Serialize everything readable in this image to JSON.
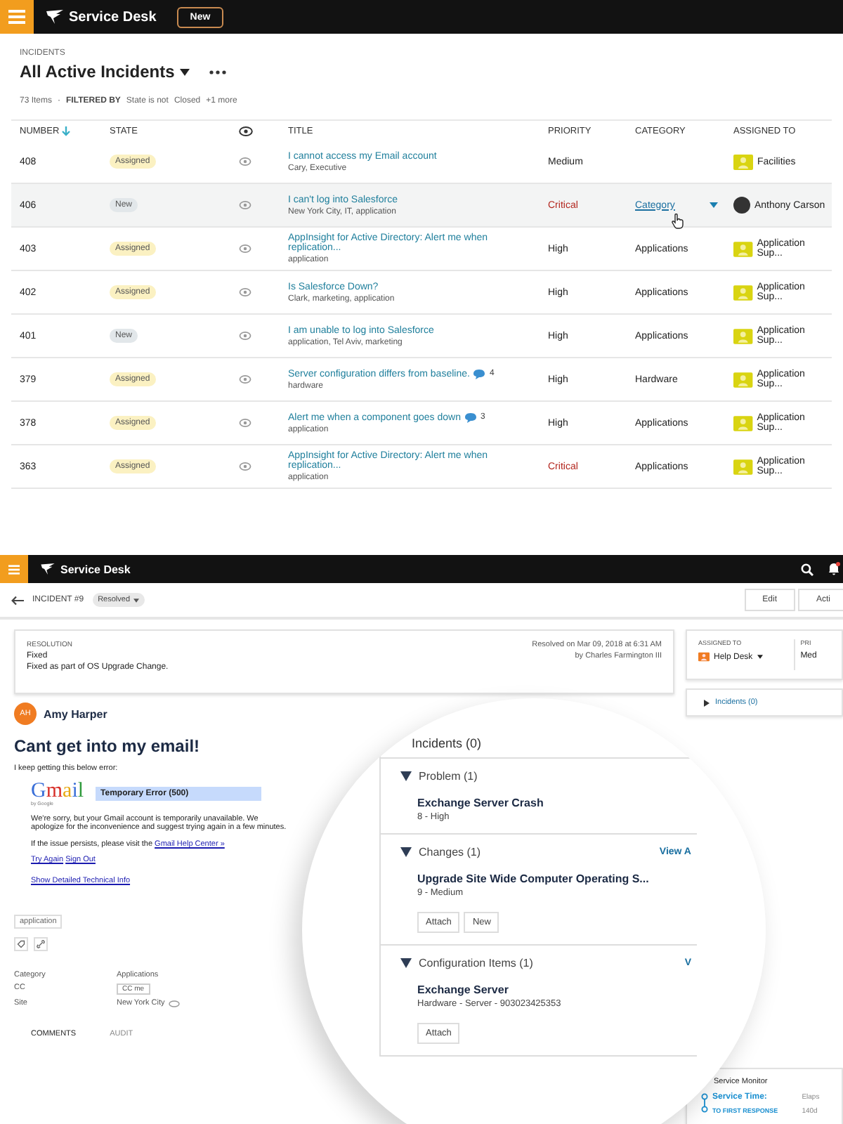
{
  "list_screen": {
    "app_title": "Service Desk",
    "new_button": "New",
    "breadcrumb": "INCIDENTS",
    "view_title": "All Active Incidents",
    "item_count": "73 Items",
    "separator": "·",
    "filter_label": "FILTERED BY",
    "filters": [
      "State is not",
      "Closed",
      "+1 more"
    ],
    "columns": [
      {
        "label": "NUMBER",
        "kind": "sorted"
      },
      {
        "label": "STATE",
        "kind": "text"
      },
      {
        "kind": "eye"
      },
      {
        "label": "TITLE",
        "kind": "text"
      },
      {
        "label": "PRIORITY",
        "kind": "text"
      },
      {
        "label": "CATEGORY",
        "kind": "text"
      },
      {
        "label": "ASSIGNED TO",
        "kind": "text"
      }
    ],
    "rows": [
      {
        "number": "408",
        "badge": {
          "label": "Assigned",
          "kind": "assigned"
        },
        "title": "I cannot access my Email account",
        "tags": "Cary, Executive",
        "priority": "Medium",
        "critical": false,
        "category_link": false,
        "assignee": {
          "name": "Facilities",
          "kind": "group"
        },
        "selected": false
      },
      {
        "number": "406",
        "badge": {
          "label": "New",
          "kind": "new"
        },
        "title": "I can't log into Salesforce",
        "tags": "New York City, IT, application",
        "priority": "Critical",
        "critical": true,
        "category": "Category",
        "category_link": true,
        "assignee": {
          "name": "Anthony Carson",
          "kind": "person"
        },
        "selected": true
      },
      {
        "number": "403",
        "badge": {
          "label": "Assigned",
          "kind": "assigned"
        },
        "title": "AppInsight for Active Directory: Alert me when replication...",
        "tags": "application",
        "priority": "High",
        "critical": false,
        "category": "Applications",
        "category_link": false,
        "assignee": {
          "name": "Application Sup...",
          "kind": "group"
        },
        "selected": false
      },
      {
        "number": "402",
        "badge": {
          "label": "Assigned",
          "kind": "assigned"
        },
        "title": "Is Salesforce Down?",
        "tags": "Clark, marketing, application",
        "priority": "High",
        "critical": false,
        "category": "Applications",
        "category_link": false,
        "assignee": {
          "name": "Application Sup...",
          "kind": "group"
        },
        "selected": false
      },
      {
        "number": "401",
        "badge": {
          "label": "New",
          "kind": "new"
        },
        "title": "I am unable to log into Salesforce",
        "tags": "application, Tel Aviv, marketing",
        "priority": "High",
        "critical": false,
        "category": "Applications",
        "category_link": false,
        "assignee": {
          "name": "Application Sup...",
          "kind": "group"
        },
        "selected": false
      },
      {
        "number": "379",
        "badge": {
          "label": "Assigned",
          "kind": "assigned"
        },
        "title": "Server configuration differs from baseline.",
        "comments": "4",
        "tags": "hardware",
        "priority": "High",
        "critical": false,
        "category": "Hardware",
        "category_link": false,
        "assignee": {
          "name": "Application Sup...",
          "kind": "group"
        },
        "selected": false
      },
      {
        "number": "378",
        "badge": {
          "label": "Assigned",
          "kind": "assigned"
        },
        "title": "Alert me when a component goes down",
        "comments": "3",
        "tags": "application",
        "priority": "High",
        "critical": false,
        "category": "Applications",
        "category_link": false,
        "assignee": {
          "name": "Application Sup...",
          "kind": "group"
        },
        "selected": false
      },
      {
        "number": "363",
        "badge": {
          "label": "Assigned",
          "kind": "assigned"
        },
        "title": "AppInsight for Active Directory: Alert me when replication...",
        "tags": "application",
        "priority": "Critical",
        "critical": true,
        "category": "Applications",
        "category_link": false,
        "assignee": {
          "name": "Application Sup...",
          "kind": "group"
        },
        "selected": false
      }
    ]
  },
  "detail_screen": {
    "app_title": "Service Desk",
    "breadcrumb": "INCIDENT #9",
    "status": "Resolved",
    "buttons": [
      "Edit",
      "Acti"
    ],
    "resolution": {
      "label": "RESOLUTION",
      "value": "Fixed",
      "note": "Fixed as part of OS Upgrade Change.",
      "resolved_on": "Resolved on Mar 09, 2018 at 6:31 AM",
      "resolved_by": "by Charles Farmington III"
    },
    "requester": {
      "initials": "AH",
      "name": "Amy Harper"
    },
    "subject": "Cant get into my email!",
    "intro": "I keep getting this below error:",
    "gmail": {
      "wordmark": "Gmail",
      "byline": "by Google",
      "error": "Temporary Error (500)",
      "message": "We're sorry, but your Gmail account is temporarily unavailable. We apologize for the inconvenience and suggest trying again in a few minutes.",
      "help_prefix": "If the issue persists, please visit the",
      "help_link": "Gmail Help Center »",
      "links": [
        "Try Again",
        "Sign Out"
      ],
      "details_link": "Show Detailed Technical Info"
    },
    "tags": [
      "application"
    ],
    "fields": [
      {
        "label": "Category",
        "value": "Applications",
        "kind": "text"
      },
      {
        "label": "CC",
        "value": "CC me",
        "kind": "chip"
      },
      {
        "label": "Site",
        "value": "New York City",
        "kind": "location"
      }
    ],
    "tabs": [
      {
        "label": "COMMENTS",
        "selected": true
      },
      {
        "label": "AUDIT",
        "selected": false
      }
    ],
    "sidebar": {
      "assigned_label": "ASSIGNED TO",
      "assigned_value": "Help Desk",
      "priority_label": "PRI",
      "priority_value": "Med",
      "incidents": "Incidents (0)",
      "monitor_title": "Service Monitor",
      "service_time": "Service Time:",
      "elapsed": "Elaps",
      "first_response": "TO FIRST RESPONSE",
      "first_value": "140d"
    },
    "magnifier": {
      "incidents": "Incidents (0)",
      "sections": [
        {
          "title": "Problem",
          "count": "(1)",
          "items": [
            {
              "title": "Exchange Server Crash",
              "sub": "8 - High"
            }
          ]
        },
        {
          "title": "Changes",
          "count": "(1)",
          "link": "View A",
          "items": [
            {
              "title": "Upgrade Site Wide Computer Operating S...",
              "sub": "9 - Medium"
            }
          ],
          "buttons": [
            "Attach",
            "New"
          ]
        },
        {
          "title": "Configuration Items",
          "count": "(1)",
          "link": "V",
          "items": [
            {
              "title": "Exchange Server",
              "sub": "Hardware - Server - 903023425353"
            }
          ],
          "buttons": [
            "Attach"
          ]
        }
      ]
    }
  }
}
